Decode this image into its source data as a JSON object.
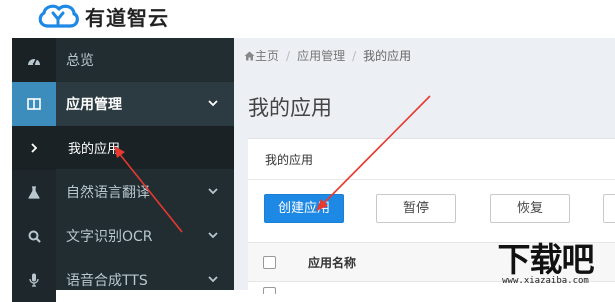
{
  "brand": {
    "name": "有道智云",
    "logo_icon": "youdao-cloud-logo-icon",
    "accent": "#1e88e5"
  },
  "sidebar": {
    "items": [
      {
        "label": "总览",
        "icon": "dashboard-icon"
      },
      {
        "label": "应用管理",
        "icon": "app-panel-icon",
        "expanded": true
      },
      {
        "label": "我的应用",
        "icon": "chevron-right-icon",
        "active": true
      },
      {
        "label": "自然语言翻译",
        "icon": "flask-icon"
      },
      {
        "label": "文字识别OCR",
        "icon": "search-icon"
      },
      {
        "label": "语音合成TTS",
        "icon": "microphone-icon"
      }
    ]
  },
  "breadcrumb": {
    "home": "主页",
    "section": "应用管理",
    "current": "我的应用"
  },
  "page": {
    "title": "我的应用"
  },
  "panel": {
    "title": "我的应用",
    "buttons": {
      "create": "创建应用",
      "pause": "暂停",
      "resume": "恢复"
    },
    "table": {
      "columns": [
        "应用名称"
      ]
    }
  },
  "watermark": {
    "text": "下载吧",
    "url": "www.xiazaiba.com"
  },
  "colors": {
    "sidebar_bg": "#222d32",
    "active_blue": "#3c8dbc",
    "button_blue": "#1e88e5",
    "arrow_red": "#e8392f"
  }
}
